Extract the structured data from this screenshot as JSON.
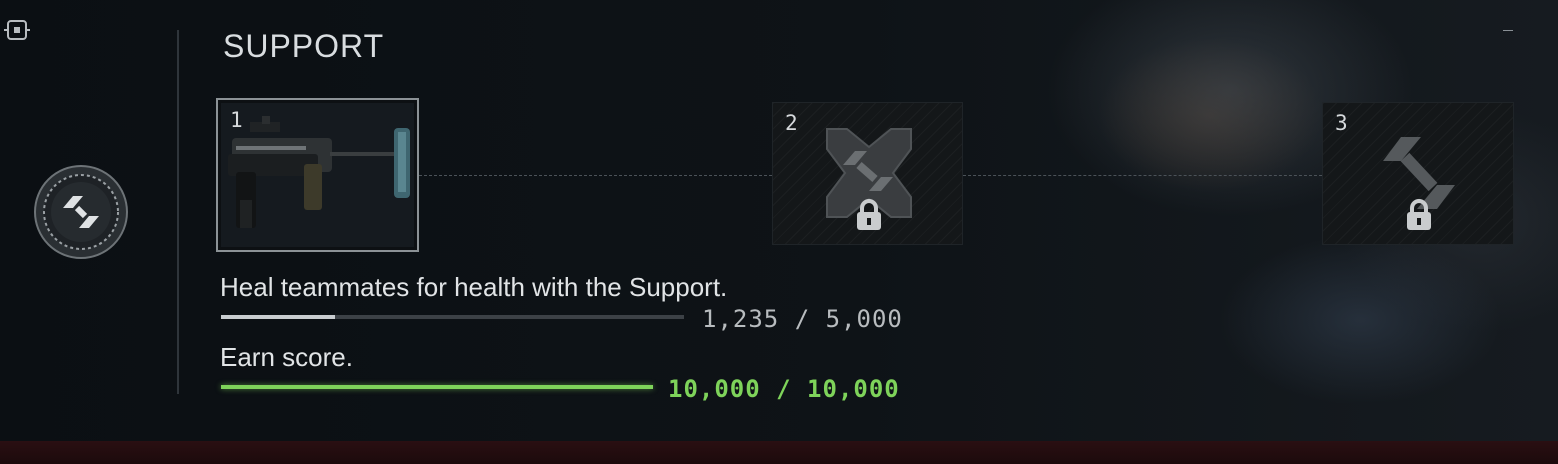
{
  "class": {
    "title": "SUPPORT",
    "emblem_icon": "support-class-icon"
  },
  "icons": {
    "corner": "crosshair-icon",
    "lock": "lock-icon",
    "minimize": "minimize-icon"
  },
  "tiers": [
    {
      "number": "1",
      "state": "unlocked",
      "image": "grenade-launcher-weapon"
    },
    {
      "number": "2",
      "state": "locked",
      "icon": "support-class-icon"
    },
    {
      "number": "3",
      "state": "locked",
      "icon": "support-class-icon"
    }
  ],
  "objectives": [
    {
      "text": "Heal teammates for health with the Support.",
      "progress_text": "1,235 / 5,000",
      "progress_fraction": 0.247,
      "complete": false,
      "color": "#b8bcbf"
    },
    {
      "text": "Earn score.",
      "progress_text": "10,000 / 10,000",
      "progress_fraction": 1.0,
      "complete": true,
      "color": "#7ed35a"
    }
  ]
}
